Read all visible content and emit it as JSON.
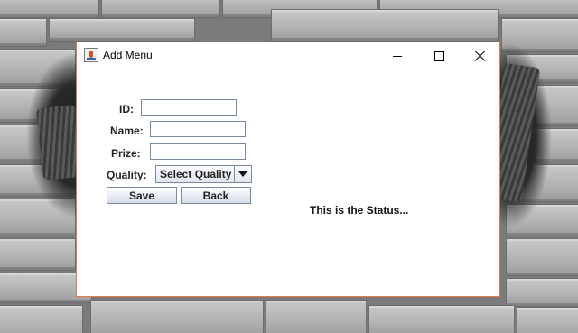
{
  "window": {
    "title": "Add Menu"
  },
  "form": {
    "id_label": "ID:",
    "id_value": "",
    "name_label": "Name:",
    "name_value": "",
    "prize_label": "Prize:",
    "prize_value": "",
    "quality_label": "Quality:",
    "quality_selected": "Select Quality"
  },
  "buttons": {
    "save": "Save",
    "back": "Back"
  },
  "status": {
    "text": "This is the Status..."
  },
  "icons": [
    "java-app-icon",
    "minimize-icon",
    "maximize-icon",
    "close-icon",
    "chevron-down-icon"
  ],
  "colors": {
    "window_border": "#e07a4f",
    "window_bg": "#ffffff",
    "button_border": "#7a8aa0"
  }
}
